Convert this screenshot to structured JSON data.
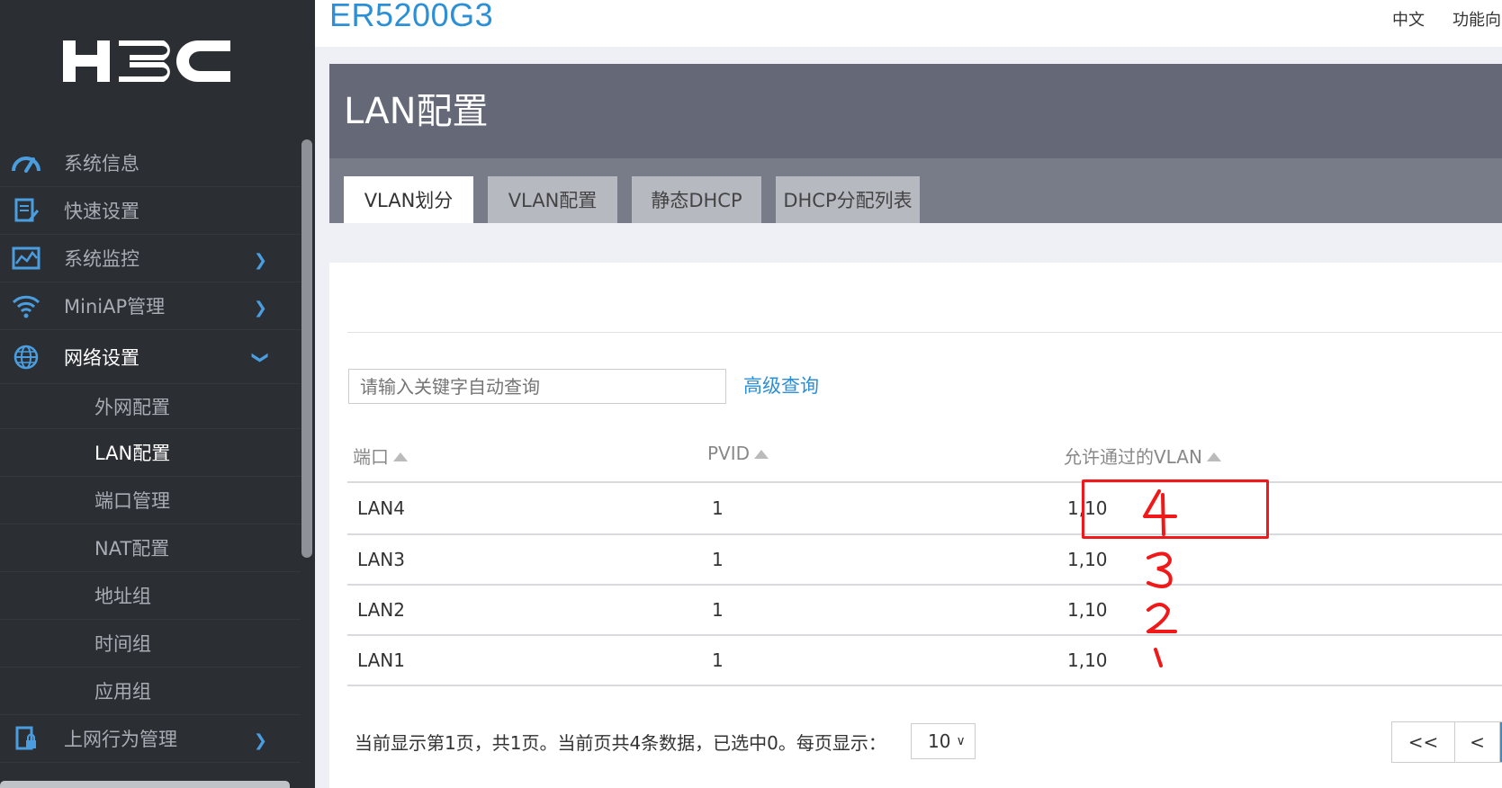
{
  "header": {
    "product_name": "ER5200G3",
    "lang_label": "中文",
    "wizard_label": "功能向"
  },
  "sidebar": {
    "logo_text": "H3C",
    "items": [
      {
        "label": "系统信息",
        "icon": "gauge-icon"
      },
      {
        "label": "快速设置",
        "icon": "clipboard-edit-icon"
      },
      {
        "label": "系统监控",
        "icon": "monitor-chart-icon",
        "chevron": "right"
      },
      {
        "label": "MiniAP管理",
        "icon": "wifi-icon",
        "chevron": "right"
      },
      {
        "label": "网络设置",
        "icon": "globe-icon",
        "chevron": "down"
      }
    ],
    "sub_items": [
      {
        "label": "外网配置"
      },
      {
        "label": "LAN配置"
      },
      {
        "label": "端口管理"
      },
      {
        "label": "NAT配置"
      },
      {
        "label": "地址组"
      },
      {
        "label": "时间组"
      },
      {
        "label": "应用组"
      }
    ],
    "bottom_item": {
      "label": "上网行为管理",
      "icon": "doc-lock-icon",
      "chevron": "right"
    }
  },
  "page": {
    "title": "LAN配置",
    "tabs": [
      {
        "label": "VLAN划分",
        "active": true
      },
      {
        "label": "VLAN配置",
        "active": false
      },
      {
        "label": "静态DHCP",
        "active": false
      },
      {
        "label": "DHCP分配列表",
        "active": false
      }
    ]
  },
  "search": {
    "placeholder": "请输入关键字自动查询",
    "advanced_label": "高级查询"
  },
  "table": {
    "columns": [
      "端口",
      "PVID",
      "允许通过的VLAN"
    ],
    "rows": [
      {
        "port": "LAN4",
        "pvid": "1",
        "vlans": "1,10"
      },
      {
        "port": "LAN3",
        "pvid": "1",
        "vlans": "1,10"
      },
      {
        "port": "LAN2",
        "pvid": "1",
        "vlans": "1,10"
      },
      {
        "port": "LAN1",
        "pvid": "1",
        "vlans": "1,10"
      }
    ]
  },
  "annotations": {
    "color": "#f01818",
    "handwritten": [
      "4",
      "3",
      "2",
      "1"
    ]
  },
  "footer": {
    "summary": "当前显示第1页，共1页。当前页共4条数据，已选中0。每页显示：",
    "page_size": "10",
    "first_label": "<<",
    "prev_label": "<"
  }
}
